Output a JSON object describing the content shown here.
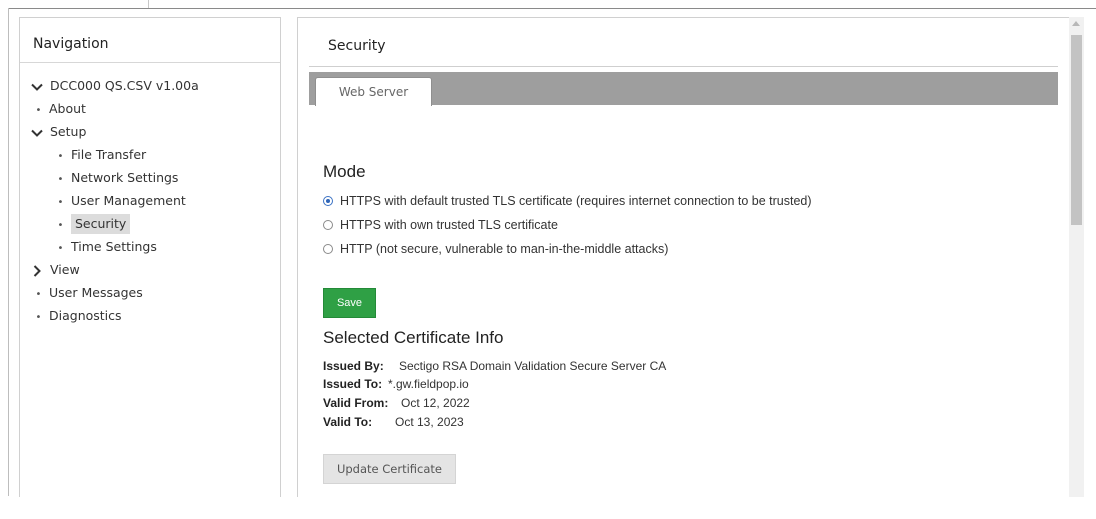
{
  "navigation": {
    "title": "Navigation",
    "root": {
      "label": "DCC000 QS.CSV v1.00a",
      "expanded": true
    },
    "items": [
      {
        "label": "About"
      },
      {
        "label": "Setup",
        "expanded": true,
        "children": [
          {
            "label": "File Transfer"
          },
          {
            "label": "Network Settings"
          },
          {
            "label": "User Management"
          },
          {
            "label": "Security",
            "selected": true
          },
          {
            "label": "Time Settings"
          }
        ]
      },
      {
        "label": "View",
        "expanded": false
      },
      {
        "label": "User Messages"
      },
      {
        "label": "Diagnostics"
      }
    ]
  },
  "security": {
    "title": "Security",
    "tab": "Web Server",
    "mode": {
      "heading": "Mode",
      "options": [
        {
          "label": "HTTPS with default trusted TLS certificate (requires internet connection to be trusted)",
          "selected": true
        },
        {
          "label": "HTTPS with own trusted TLS certificate",
          "selected": false
        },
        {
          "label": "HTTP (not secure, vulnerable to man-in-the-middle attacks)",
          "selected": false
        }
      ]
    },
    "save_label": "Save",
    "certificate": {
      "heading": "Selected Certificate Info",
      "issued_by_label": "Issued By:",
      "issued_by": "Sectigo RSA Domain Validation Secure Server CA",
      "issued_to_label": "Issued To:",
      "issued_to": "*.gw.fieldpop.io",
      "valid_from_label": "Valid From:",
      "valid_from": "Oct 12, 2022",
      "valid_to_label": "Valid To:",
      "valid_to": "Oct 13, 2023"
    },
    "update_label": "Update Certificate"
  },
  "colors": {
    "save_button": "#2fa045",
    "tab_bar": "#9e9e9e",
    "selected_item": "#dcdcdc",
    "radio_selected": "#2f65b8"
  }
}
